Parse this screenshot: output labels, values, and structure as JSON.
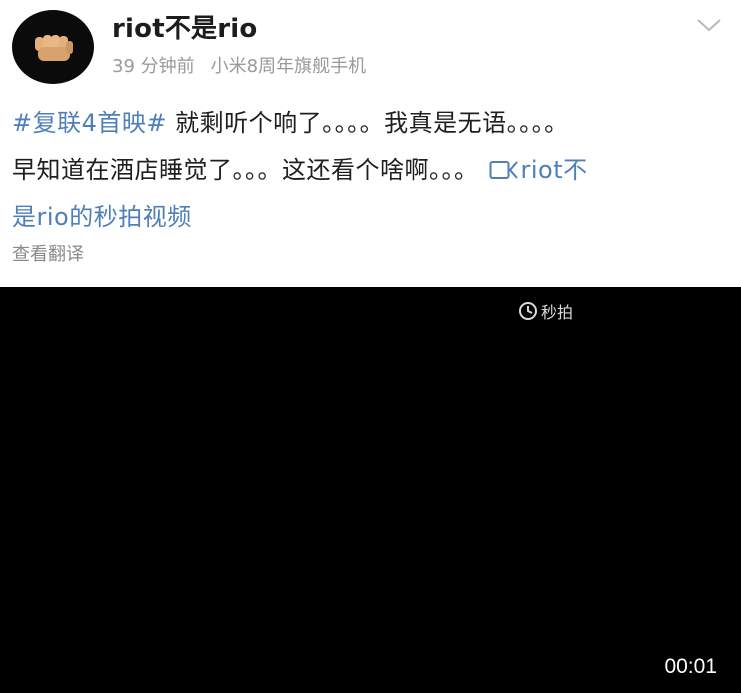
{
  "post_header": {
    "username": "riot不是rio",
    "time_ago": "39 分钟前",
    "device": "小米8周年旗舰手机"
  },
  "post_body": {
    "hashtag": "#复联4首映#",
    "line1_text": "就剩听个响了。。。。我真是无语。。。。",
    "line2_text": "早知道在酒店睡觉了。。。这还看个啥啊。。。",
    "video_link_part1": "riot不",
    "video_link_part2": "是rio的秒拍视频"
  },
  "translate_label": "查看翻译",
  "video": {
    "watermark_text": "秒拍",
    "timestamp": "00:01"
  },
  "icons": {
    "avatar": "fist-icon",
    "chevron": "chevron-down-icon",
    "video_link": "video-camera-icon",
    "watermark": "miaopai-logo-icon"
  }
}
